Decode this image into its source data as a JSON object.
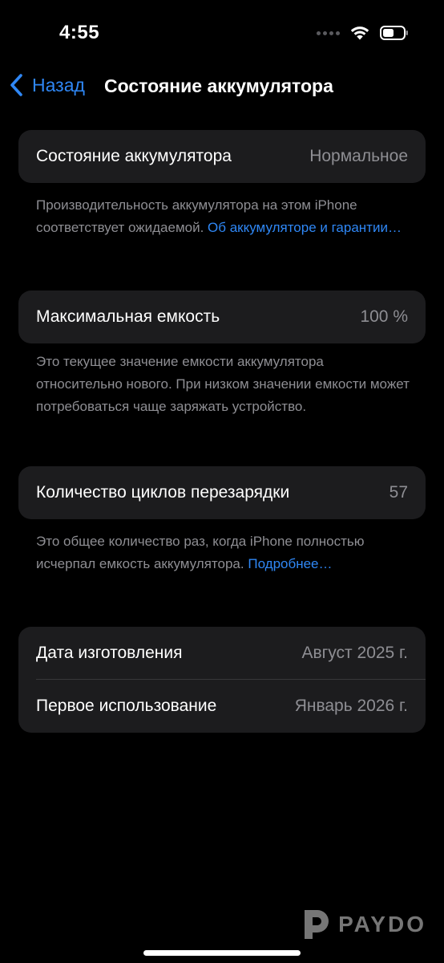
{
  "status_bar": {
    "time": "4:55"
  },
  "nav": {
    "back_label": "Назад",
    "title": "Состояние аккумулятора"
  },
  "health": {
    "label": "Состояние аккумулятора",
    "value": "Нормальное",
    "note_text": "Производительность аккумулятора на этом iPhone соответствует ожидаемой.",
    "note_link": "Об аккумуляторе и гарантии…"
  },
  "capacity": {
    "label": "Максимальная емкость",
    "value": "100 %",
    "note_text": "Это текущее значение емкости аккумулятора относительно нового. При низком значении емкости может потребоваться чаще заряжать устройство."
  },
  "cycles": {
    "label": "Количество циклов перезарядки",
    "value": "57",
    "note_text": "Это общее количество раз, когда iPhone полностью исчерпал емкость аккумулятора.",
    "note_link": "Подробнее…"
  },
  "dates": {
    "manufacture_label": "Дата изготовления",
    "manufacture_value": "Август 2025 г.",
    "first_use_label": "Первое использование",
    "first_use_value": "Январь 2026 г."
  },
  "watermark": {
    "text": "PAYDO"
  },
  "colors": {
    "background": "#000000",
    "cell": "#1c1c1e",
    "accent": "#2f87f5",
    "secondary_text": "#8e8e93"
  }
}
